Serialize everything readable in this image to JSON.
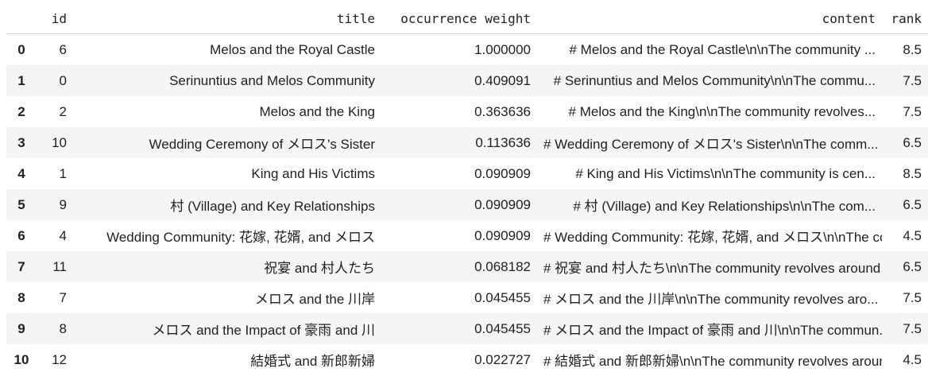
{
  "columns": [
    "",
    "id",
    "title",
    "occurrence weight",
    "content",
    "rank"
  ],
  "rows": [
    {
      "index": "0",
      "id": "6",
      "title": "Melos and the Royal Castle",
      "weight": "1.000000",
      "content": "# Melos and the Royal Castle\\n\\nThe community ...",
      "rank": "8.5"
    },
    {
      "index": "1",
      "id": "0",
      "title": "Serinuntius and Melos Community",
      "weight": "0.409091",
      "content": "# Serinuntius and Melos Community\\n\\nThe commu...",
      "rank": "7.5"
    },
    {
      "index": "2",
      "id": "2",
      "title": "Melos and the King",
      "weight": "0.363636",
      "content": "# Melos and the King\\n\\nThe community revolves...",
      "rank": "7.5"
    },
    {
      "index": "3",
      "id": "10",
      "title": "Wedding Ceremony of メロス's Sister",
      "weight": "0.113636",
      "content": "# Wedding Ceremony of メロス's Sister\\n\\nThe comm...",
      "rank": "6.5"
    },
    {
      "index": "4",
      "id": "1",
      "title": "King and His Victims",
      "weight": "0.090909",
      "content": "# King and His Victims\\n\\nThe community is cen...",
      "rank": "8.5"
    },
    {
      "index": "5",
      "id": "9",
      "title": "村 (Village) and Key Relationships",
      "weight": "0.090909",
      "content": "# 村 (Village) and Key Relationships\\n\\nThe com...",
      "rank": "6.5"
    },
    {
      "index": "6",
      "id": "4",
      "title": "Wedding Community: 花嫁, 花婿, and メロス",
      "weight": "0.090909",
      "content": "# Wedding Community: 花嫁, 花婿, and メロス\\n\\nThe co...",
      "rank": "4.5"
    },
    {
      "index": "7",
      "id": "11",
      "title": "祝宴 and 村人たち",
      "weight": "0.068182",
      "content": "# 祝宴 and 村人たち\\n\\nThe community revolves around...",
      "rank": "6.5"
    },
    {
      "index": "8",
      "id": "7",
      "title": "メロス and the 川岸",
      "weight": "0.045455",
      "content": "# メロス and the 川岸\\n\\nThe community revolves aro...",
      "rank": "7.5"
    },
    {
      "index": "9",
      "id": "8",
      "title": "メロス and the Impact of 豪雨 and 川",
      "weight": "0.045455",
      "content": "# メロス and the Impact of 豪雨 and 川\\n\\nThe commun...",
      "rank": "7.5"
    },
    {
      "index": "10",
      "id": "12",
      "title": "結婚式 and 新郎新婦",
      "weight": "0.022727",
      "content": "# 結婚式 and 新郎新婦\\n\\nThe community revolves aroun...",
      "rank": "4.5"
    }
  ]
}
